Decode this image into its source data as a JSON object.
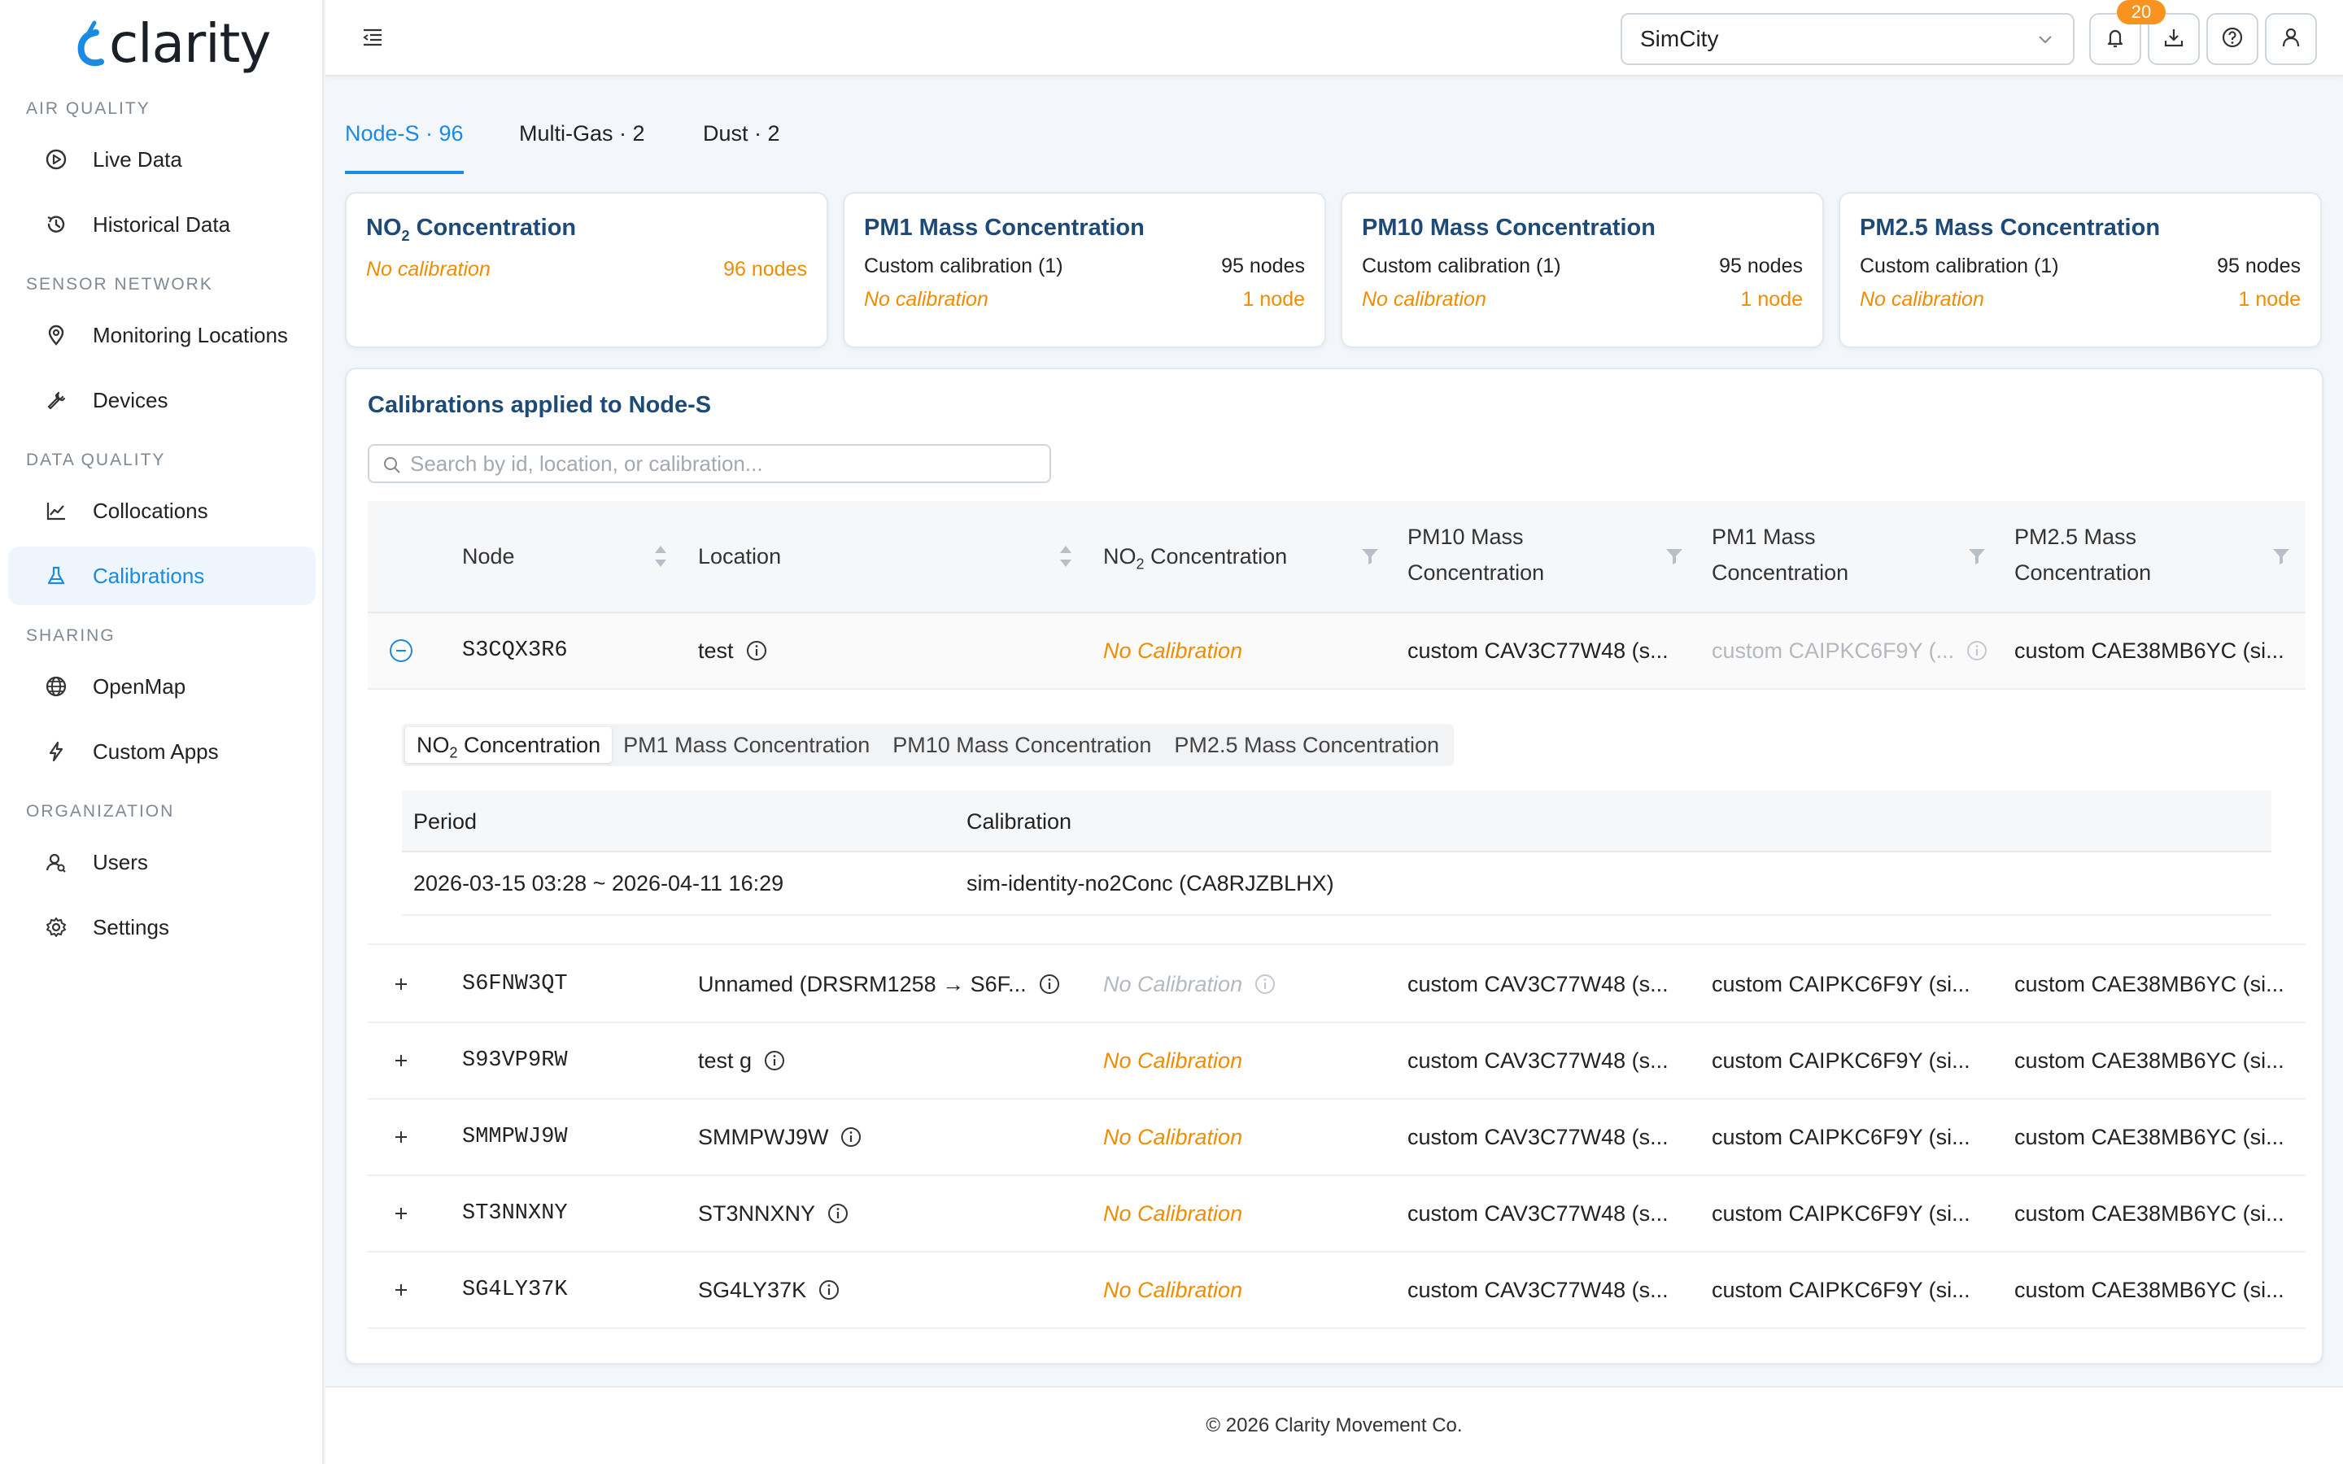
{
  "brand": {
    "name": "clarity"
  },
  "sidebar": {
    "sections": [
      {
        "title": "Air Quality",
        "items": [
          {
            "label": "Live Data",
            "icon": "play-circle-icon"
          },
          {
            "label": "Historical Data",
            "icon": "history-icon"
          }
        ]
      },
      {
        "title": "Sensor Network",
        "items": [
          {
            "label": "Monitoring Locations",
            "icon": "location-pin-icon"
          },
          {
            "label": "Devices",
            "icon": "wrench-icon"
          }
        ]
      },
      {
        "title": "Data Quality",
        "items": [
          {
            "label": "Collocations",
            "icon": "line-chart-icon"
          },
          {
            "label": "Calibrations",
            "icon": "flask-icon",
            "active": true
          }
        ]
      },
      {
        "title": "Sharing",
        "items": [
          {
            "label": "OpenMap",
            "icon": "globe-icon"
          },
          {
            "label": "Custom Apps",
            "icon": "lightning-icon"
          }
        ]
      },
      {
        "title": "Organization",
        "items": [
          {
            "label": "Users",
            "icon": "users-icon"
          },
          {
            "label": "Settings",
            "icon": "gear-icon"
          }
        ]
      }
    ]
  },
  "header": {
    "org_select": "SimCity",
    "notifications_count": "20"
  },
  "tabs": [
    {
      "label": "Node-S · 96",
      "active": true
    },
    {
      "label": "Multi-Gas · 2"
    },
    {
      "label": "Dust · 2"
    }
  ],
  "cards": [
    {
      "title_main": "NO",
      "title_sub": "2",
      "title_rest": " Concentration",
      "rows": [
        {
          "left": "No calibration",
          "right": "96 nodes",
          "style": "nocal"
        }
      ]
    },
    {
      "title": "PM1 Mass Concentration",
      "rows": [
        {
          "left": "Custom calibration (1)",
          "right": "95 nodes"
        },
        {
          "left": "No calibration",
          "right": "1 node",
          "style": "nocal"
        }
      ]
    },
    {
      "title": "PM10 Mass Concentration",
      "rows": [
        {
          "left": "Custom calibration (1)",
          "right": "95 nodes"
        },
        {
          "left": "No calibration",
          "right": "1 node",
          "style": "nocal"
        }
      ]
    },
    {
      "title": "PM2.5 Mass Concentration",
      "rows": [
        {
          "left": "Custom calibration (1)",
          "right": "95 nodes"
        },
        {
          "left": "No calibration",
          "right": "1 node",
          "style": "nocal"
        }
      ]
    }
  ],
  "panel": {
    "title": "Calibrations applied to Node-S",
    "search_placeholder": "Search by id, location, or calibration..."
  },
  "table": {
    "columns": {
      "node": "Node",
      "location": "Location",
      "no2_main": "NO",
      "no2_sub": "2",
      "no2_rest": " Concentration",
      "pm10_l1": "PM10 Mass",
      "pm10_l2": "Concentration",
      "pm1_l1": "PM1 Mass",
      "pm1_l2": "Concentration",
      "pm25_l1": "PM2.5 Mass",
      "pm25_l2": "Concentration"
    },
    "rows": [
      {
        "node": "S3CQX3R6",
        "location": "test",
        "no2": "No Calibration",
        "pm10": "custom CAV3C77W48 (s...",
        "pm1": "custom CAIPKC6F9Y (...",
        "pm25": "custom CAE38MB6YC (si...",
        "expanded": true
      },
      {
        "node": "S6FNW3QT",
        "location": "Unnamed (DRSRM1258 → S6F...",
        "no2": "No Calibration",
        "pm10": "custom CAV3C77W48 (s...",
        "pm1": "custom CAIPKC6F9Y (si...",
        "pm25": "custom CAE38MB6YC (si..."
      },
      {
        "node": "S93VP9RW",
        "location": "test g",
        "no2": "No Calibration",
        "pm10": "custom CAV3C77W48 (s...",
        "pm1": "custom CAIPKC6F9Y (si...",
        "pm25": "custom CAE38MB6YC (si..."
      },
      {
        "node": "SMMPWJ9W",
        "location": "SMMPWJ9W",
        "no2": "No Calibration",
        "pm10": "custom CAV3C77W48 (s...",
        "pm1": "custom CAIPKC6F9Y (si...",
        "pm25": "custom CAE38MB6YC (si..."
      },
      {
        "node": "ST3NNXNY",
        "location": "ST3NNXNY",
        "no2": "No Calibration",
        "pm10": "custom CAV3C77W48 (s...",
        "pm1": "custom CAIPKC6F9Y (si...",
        "pm25": "custom CAE38MB6YC (si..."
      },
      {
        "node": "SG4LY37K",
        "location": "SG4LY37K",
        "no2": "No Calibration",
        "pm10": "custom CAV3C77W48 (s...",
        "pm1": "custom CAIPKC6F9Y (si...",
        "pm25": "custom CAE38MB6YC (si..."
      }
    ],
    "expanded_detail": {
      "subtabs": {
        "no2_main": "NO",
        "no2_sub": "2",
        "no2_rest": " Concentration",
        "pm1": "PM1 Mass Concentration",
        "pm10": "PM10 Mass Concentration",
        "pm25": "PM2.5 Mass Concentration"
      },
      "columns": {
        "period": "Period",
        "calibration": "Calibration"
      },
      "rows": [
        {
          "period": "2026-03-15 03:28 ~ 2026-04-11 16:29",
          "calibration": "sim-identity-no2Conc (CA8RJZBLHX)"
        }
      ]
    }
  },
  "footer": {
    "text": "© 2026 Clarity Movement Co."
  },
  "colors": {
    "accent": "#1a8ae2",
    "title_navy": "#1e4a78",
    "warning_orange": "#f08c00",
    "badge_orange": "#f7931e"
  }
}
